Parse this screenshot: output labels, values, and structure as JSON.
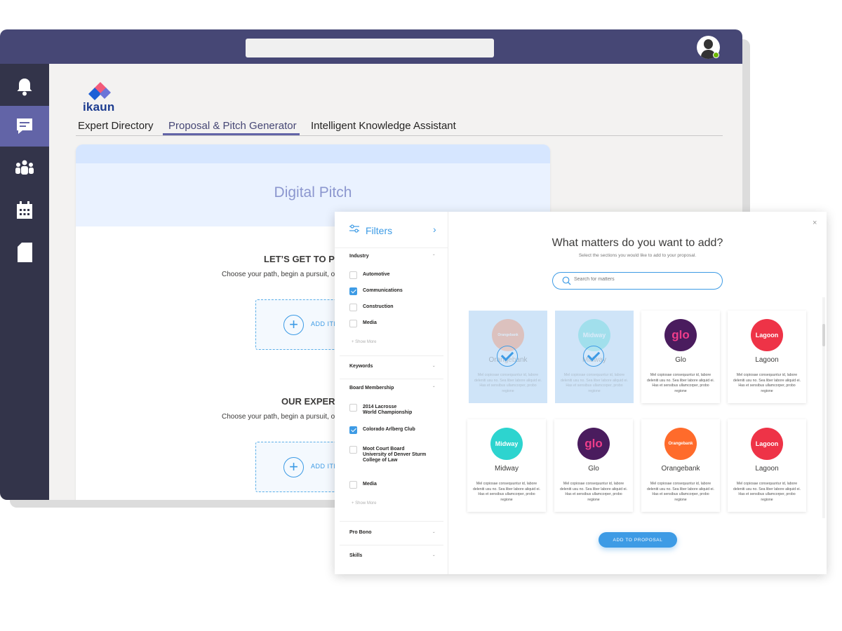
{
  "app": {
    "top_search_placeholder": "",
    "logo_text": "ikaun",
    "tabs": [
      {
        "label": "Expert Directory"
      },
      {
        "label": "Proposal & Pitch Generator"
      },
      {
        "label": "Intelligent Knowledge Assistant"
      }
    ],
    "rail_icons": [
      "bell-icon",
      "chat-icon",
      "teams-icon",
      "calendar-icon",
      "files-icon"
    ]
  },
  "pitch": {
    "title": "Digital Pitch",
    "sections": [
      {
        "title": "LET’S GET TO P",
        "subtitle": "Choose your path, begin a pursuit, or",
        "add_label": "ADD ITE"
      },
      {
        "title": "OUR EXPERT",
        "subtitle": "Choose your path, begin a pursuit, or",
        "add_label": "ADD ITE"
      }
    ]
  },
  "filters": {
    "title": "Filters",
    "industry": {
      "label": "Industry",
      "items": [
        {
          "label": "Automotive",
          "checked": false
        },
        {
          "label": "Communications",
          "checked": true
        },
        {
          "label": "Construction",
          "checked": false
        },
        {
          "label": "Media",
          "checked": false
        }
      ],
      "show_more": "+ Show More"
    },
    "keywords": {
      "label": "Keywords"
    },
    "board": {
      "label": "Board Membership",
      "items": [
        {
          "label": "2014 Lacrosse\nWorld Championship",
          "checked": false
        },
        {
          "label": "Colorado Arlberg Club",
          "checked": true
        },
        {
          "label": "Moot Court Board\nUniversity of Denver Sturm\nCollege of Law",
          "checked": false
        },
        {
          "label": "Media",
          "checked": false
        }
      ],
      "show_more": "+ Show More"
    },
    "pro_bono": {
      "label": "Pro Bono"
    },
    "skills": {
      "label": "Skills"
    }
  },
  "modal": {
    "close": "×",
    "title": "What matters do you want to add?",
    "subtitle": "Select the sections you would like to add to your proposal.",
    "search_placeholder": "Search for matters",
    "add_button": "ADD TO PROPOSAL",
    "description": "Mel copiosae consequuntur id, labore deleniti usu no. Sea liber labore aliquid ei. Has et sensibus ullamcorper, probo regione",
    "cards": [
      {
        "name": "Orangebank",
        "logo_text": "Orangebank",
        "color": "#ff6b2b",
        "selected": true
      },
      {
        "name": "Midway",
        "logo_text": "Midway",
        "color": "#2dd4cf",
        "selected": true
      },
      {
        "name": "Glo",
        "logo_text": "glo",
        "color": "#4a1c5e",
        "selected": false
      },
      {
        "name": "Lagoon",
        "logo_text": "Lagoon",
        "color": "#ee3347",
        "selected": false
      },
      {
        "name": "Midway",
        "logo_text": "Midway",
        "color": "#2dd4cf",
        "selected": false
      },
      {
        "name": "Glo",
        "logo_text": "glo",
        "color": "#4a1c5e",
        "selected": false
      },
      {
        "name": "Orangebank",
        "logo_text": "Orangebank",
        "color": "#ff6b2b",
        "selected": false
      },
      {
        "name": "Lagoon",
        "logo_text": "Lagoon",
        "color": "#ee3347",
        "selected": false
      }
    ]
  },
  "colors": {
    "accent": "#3d9be5",
    "brand": "#464775",
    "rail": "#33344a"
  }
}
